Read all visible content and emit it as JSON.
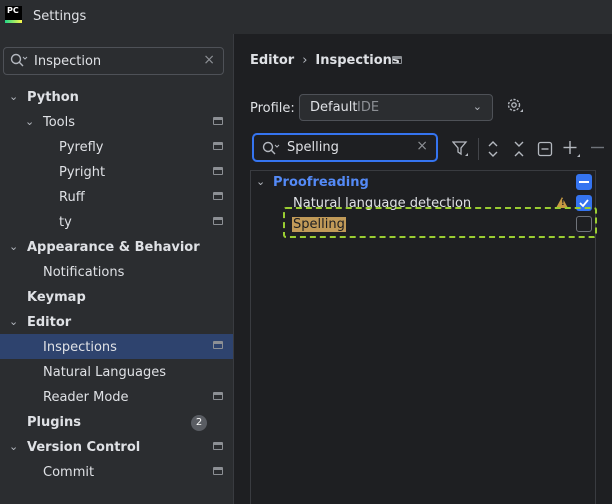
{
  "window": {
    "title": "Settings",
    "logo_text": "PC"
  },
  "sidebar": {
    "search": {
      "value": "Inspection",
      "clear": "×"
    },
    "items": [
      {
        "label": "Python"
      },
      {
        "label": "Tools"
      },
      {
        "label": "Pyrefly"
      },
      {
        "label": "Pyright"
      },
      {
        "label": "Ruff"
      },
      {
        "label": "ty"
      },
      {
        "label": "Appearance & Behavior"
      },
      {
        "label": "Notifications"
      },
      {
        "label": "Keymap"
      },
      {
        "label": "Editor"
      },
      {
        "label": "Inspections"
      },
      {
        "label": "Natural Languages"
      },
      {
        "label": "Reader Mode"
      },
      {
        "label": "Plugins",
        "badge": "2"
      },
      {
        "label": "Version Control"
      },
      {
        "label": "Commit"
      }
    ]
  },
  "main": {
    "breadcrumb": {
      "parent": "Editor",
      "sep": "›",
      "current": "Inspections"
    },
    "profile": {
      "label": "Profile:",
      "value": "Default",
      "scope": "IDE",
      "arrow": "⌄"
    },
    "filter": {
      "value": "Spelling",
      "clear": "×"
    },
    "tree": [
      {
        "label": "Proofreading",
        "state": "partial"
      },
      {
        "label": "Natural language detection",
        "state": "checked",
        "warning": "!"
      },
      {
        "label": "Spelling",
        "state": "unchecked"
      }
    ]
  },
  "colors": {
    "accent": "#3574f0",
    "selected": "#2e436e",
    "highlight_match": "#c19a58",
    "annotation": "#9acd32"
  }
}
